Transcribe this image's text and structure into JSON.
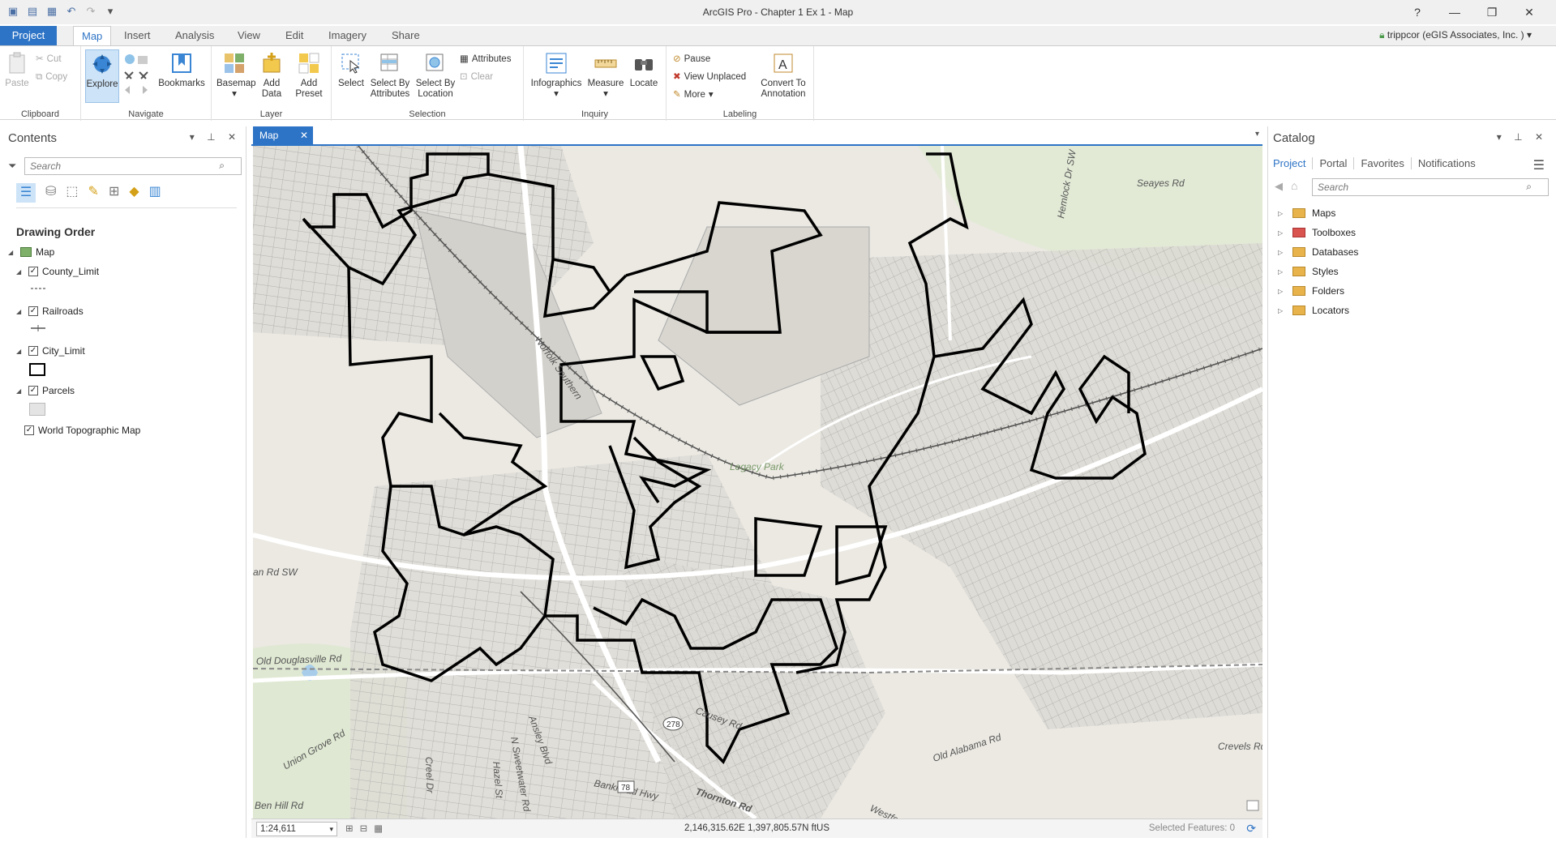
{
  "window": {
    "title": "ArcGIS Pro - Chapter 1 Ex 1 - Map",
    "help": "?"
  },
  "tabs": [
    "Project",
    "Map",
    "Insert",
    "Analysis",
    "View",
    "Edit",
    "Imagery",
    "Share"
  ],
  "account": "trippcor (eGIS Associates, Inc. )",
  "ribbon": {
    "clipboard": {
      "label": "Clipboard",
      "paste": "Paste",
      "cut": "Cut",
      "copy": "Copy"
    },
    "navigate": {
      "label": "Navigate",
      "explore": "Explore",
      "bookmarks": "Bookmarks"
    },
    "layer": {
      "label": "Layer",
      "basemap": "Basemap",
      "add_data_1": "Add",
      "add_data_2": "Data",
      "add_preset_1": "Add",
      "add_preset_2": "Preset"
    },
    "selection": {
      "label": "Selection",
      "select": "Select",
      "by_attr_1": "Select By",
      "by_attr_2": "Attributes",
      "by_loc_1": "Select By",
      "by_loc_2": "Location",
      "attributes": "Attributes",
      "clear": "Clear"
    },
    "inquiry": {
      "label": "Inquiry",
      "infographics": "Infographics",
      "measure": "Measure",
      "locate": "Locate"
    },
    "labeling": {
      "label": "Labeling",
      "pause": "Pause",
      "view_unplaced": "View Unplaced",
      "more": "More",
      "convert_1": "Convert To",
      "convert_2": "Annotation"
    }
  },
  "contents": {
    "title": "Contents",
    "search_placeholder": "Search",
    "drawing_order": "Drawing Order",
    "map_name": "Map",
    "layers": [
      {
        "name": "County_Limit",
        "checked": true
      },
      {
        "name": "Railroads",
        "checked": true
      },
      {
        "name": "City_Limit",
        "checked": true
      },
      {
        "name": "Parcels",
        "checked": true
      },
      {
        "name": "World Topographic Map",
        "checked": true
      }
    ]
  },
  "map": {
    "tab_label": "Map",
    "scale": "1:24,611",
    "coordinates": "2,146,315.62E 1,397,805.57N ftUS",
    "selected_features": "Selected Features: 0",
    "street_labels": [
      "Seayes Rd",
      "Hemlock Dr SW",
      "Legacy Park",
      "Old Douglasville Rd",
      "Union Grove Rd",
      "Ansley Blvd",
      "N Sweetwater Rd",
      "Hazel St",
      "Ben Hill Rd",
      "Creel Dr",
      "Bankhead Hwy",
      "Thornton Rd",
      "Old Alabama Rd",
      "Causey Rd",
      "Crevels Rd",
      "an Rd SW",
      "Norfolk Southern",
      "Westfo"
    ],
    "route_shields": [
      "278",
      "78"
    ]
  },
  "catalog": {
    "title": "Catalog",
    "tabs": [
      "Project",
      "Portal",
      "Favorites",
      "Notifications"
    ],
    "search_placeholder": "Search",
    "items": [
      "Maps",
      "Toolboxes",
      "Databases",
      "Styles",
      "Folders",
      "Locators"
    ]
  }
}
